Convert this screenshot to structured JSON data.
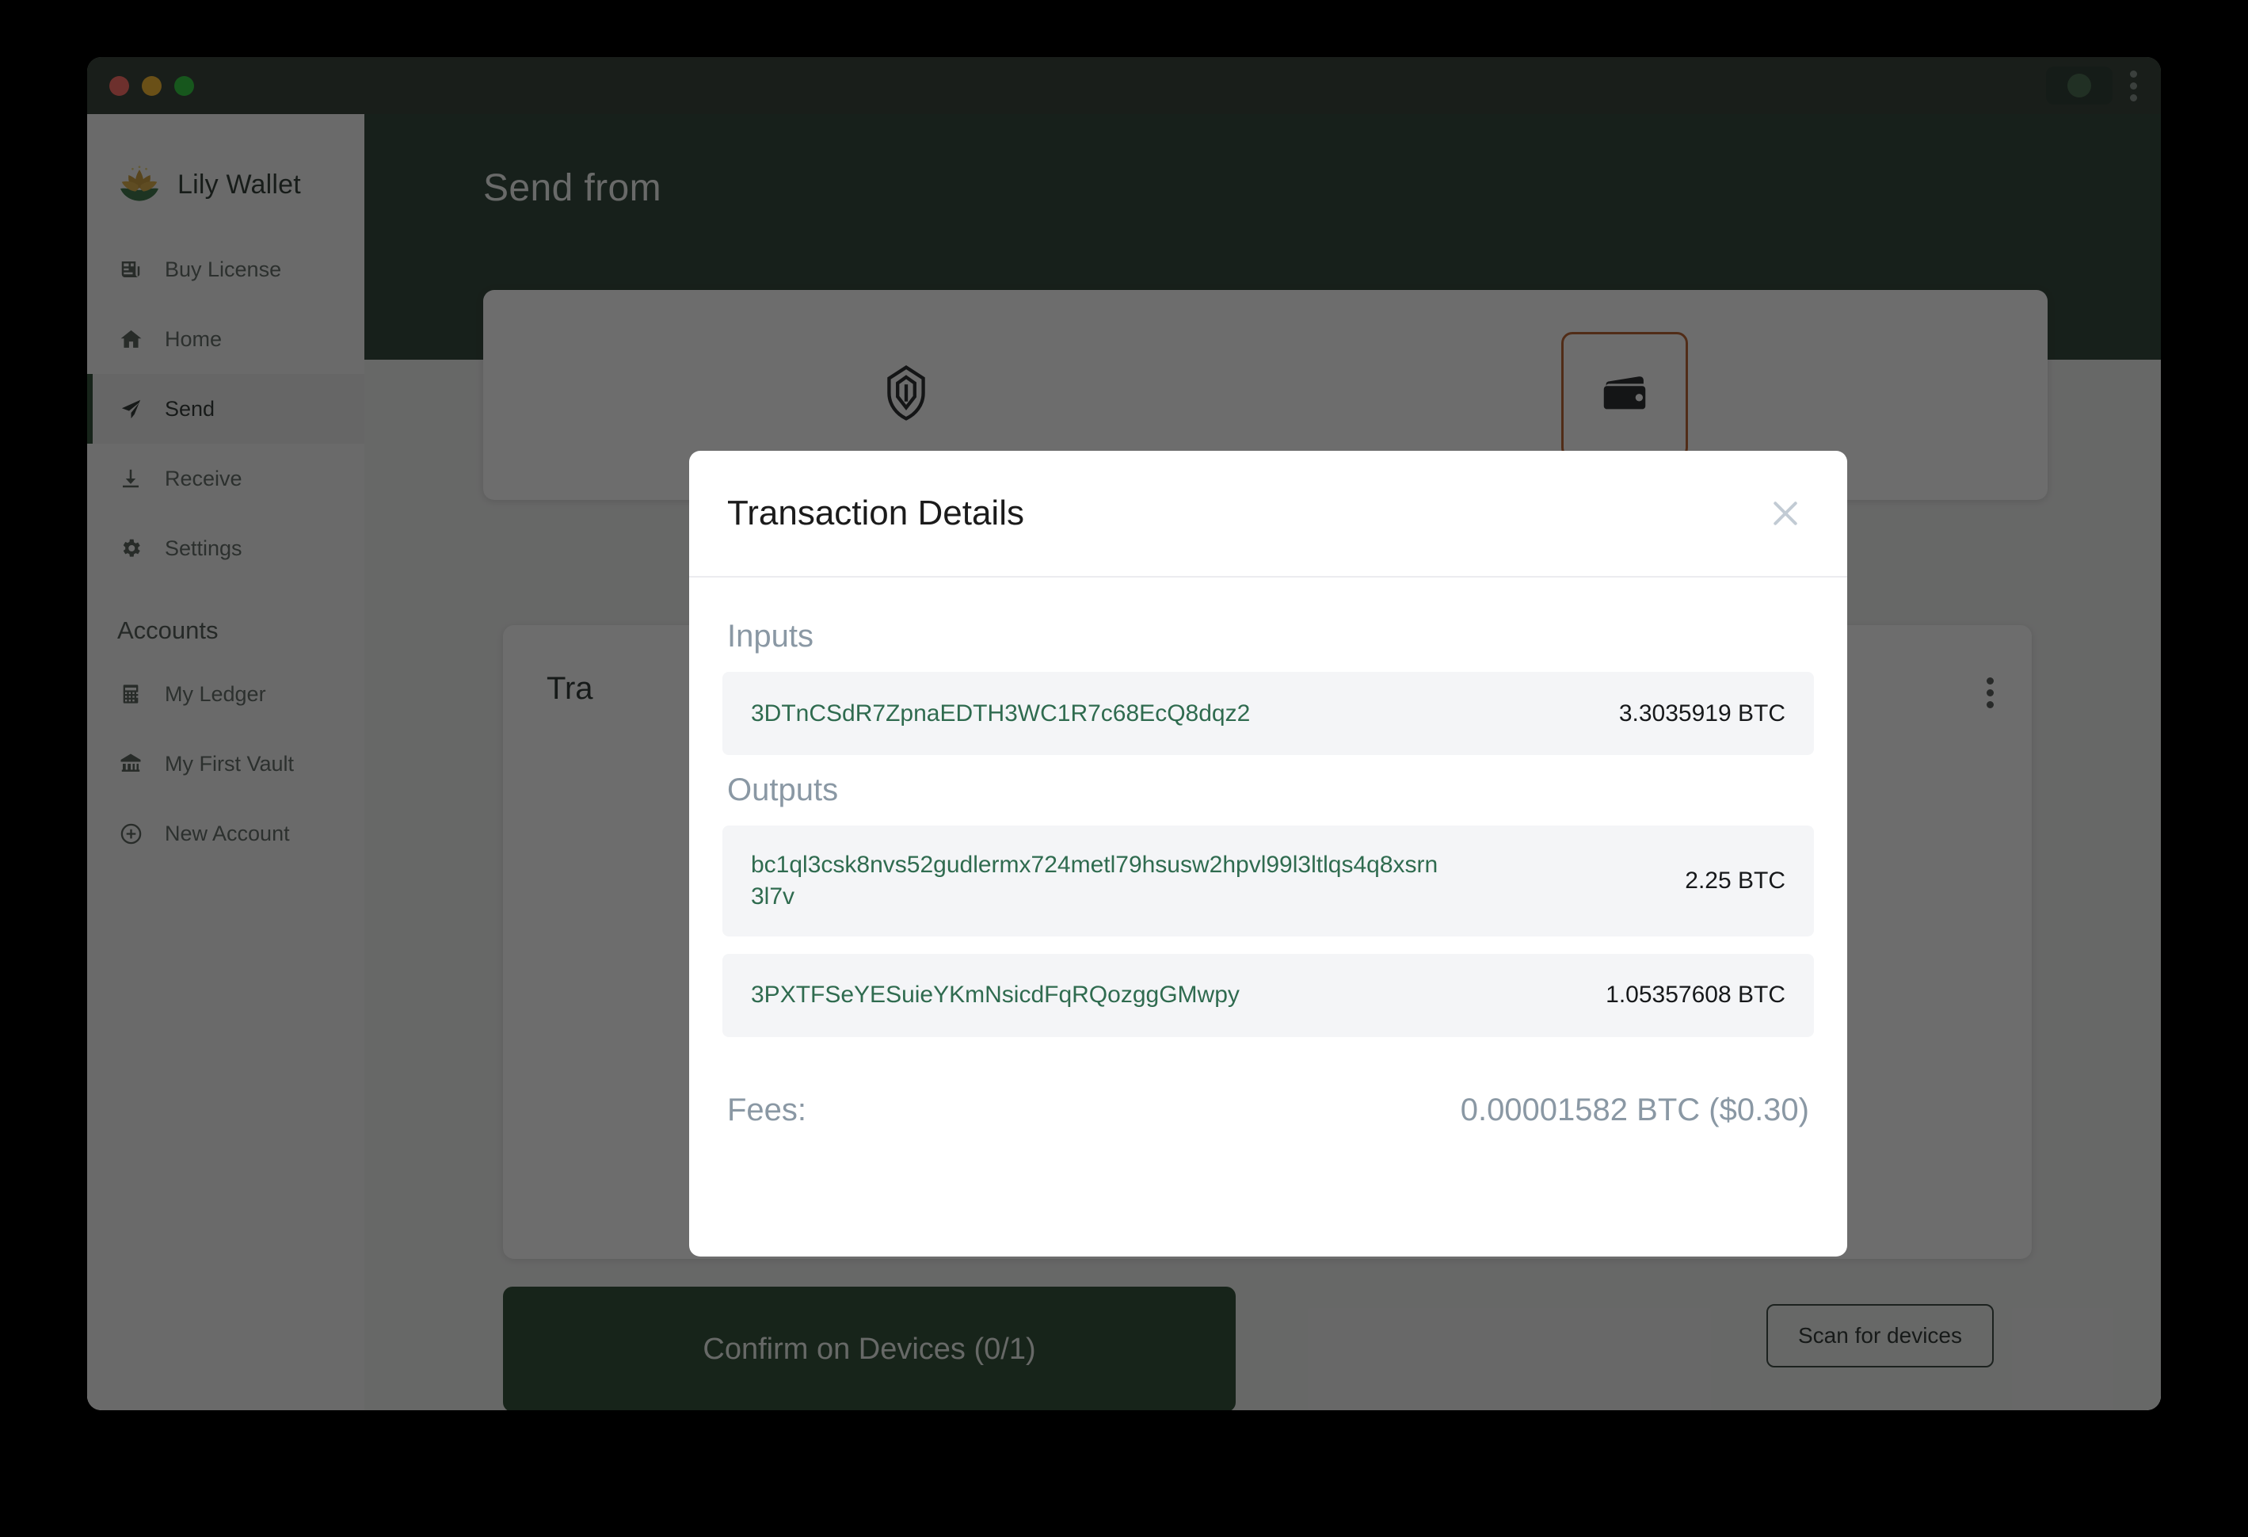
{
  "window": {
    "traffic_lights": [
      "close",
      "minimize",
      "zoom"
    ],
    "status_indicator": "connected-status-dot",
    "menu": "kebab-menu"
  },
  "sidebar": {
    "brand": {
      "name": "Lily Wallet",
      "logo": "lotus-flower-icon"
    },
    "items": [
      {
        "label": "Buy License",
        "icon": "newspaper-icon",
        "active": false
      },
      {
        "label": "Home",
        "icon": "home-icon",
        "active": false
      },
      {
        "label": "Send",
        "icon": "send-paper-plane-icon",
        "active": true
      },
      {
        "label": "Receive",
        "icon": "download-arrow-icon",
        "active": false
      },
      {
        "label": "Settings",
        "icon": "gear-icon",
        "active": false
      }
    ],
    "accounts_label": "Accounts",
    "accounts": [
      {
        "label": "My Ledger",
        "icon": "calculator-icon"
      },
      {
        "label": "My First Vault",
        "icon": "bank-icon"
      },
      {
        "label": "New Account",
        "icon": "plus-circle-icon"
      }
    ]
  },
  "main": {
    "page_title": "Send from",
    "devices": [
      {
        "name": "hardware-device-tile",
        "icon": "ledger-shield-icon",
        "selected": false
      },
      {
        "name": "wallet-device-tile",
        "icon": "wallet-icon",
        "selected": true
      }
    ],
    "tx_card_title": "Tra",
    "tx_card_menu": "kebab-menu",
    "confirm_label": "Confirm on Devices (0/1)",
    "scan_label": "Scan for devices"
  },
  "modal": {
    "title": "Transaction Details",
    "close_icon": "close-icon",
    "inputs_heading": "Inputs",
    "inputs": [
      {
        "address": "3DTnCSdR7ZpnaEDTH3WC1R7c68EcQ8dqz2",
        "amount": "3.3035919 BTC"
      }
    ],
    "outputs_heading": "Outputs",
    "outputs": [
      {
        "address": "bc1ql3csk8nvs52gudlermx724metl79hsusw2hpvl99l3ltlqs4q8xsrn3l7v",
        "amount": "2.25 BTC"
      },
      {
        "address": "3PXTFSeYESuieYKmNsicdFqRQozggGMwpy",
        "amount": "1.05357608 BTC"
      }
    ],
    "fees_label": "Fees:",
    "fees_value": "0.00001582 BTC ($0.30)"
  },
  "colors": {
    "brand_dark_green": "#1f3528",
    "titlebar": "#223026",
    "accent_orange": "#b5561f",
    "address_green": "#2f6b4f",
    "muted_gray": "#8a98a4"
  }
}
